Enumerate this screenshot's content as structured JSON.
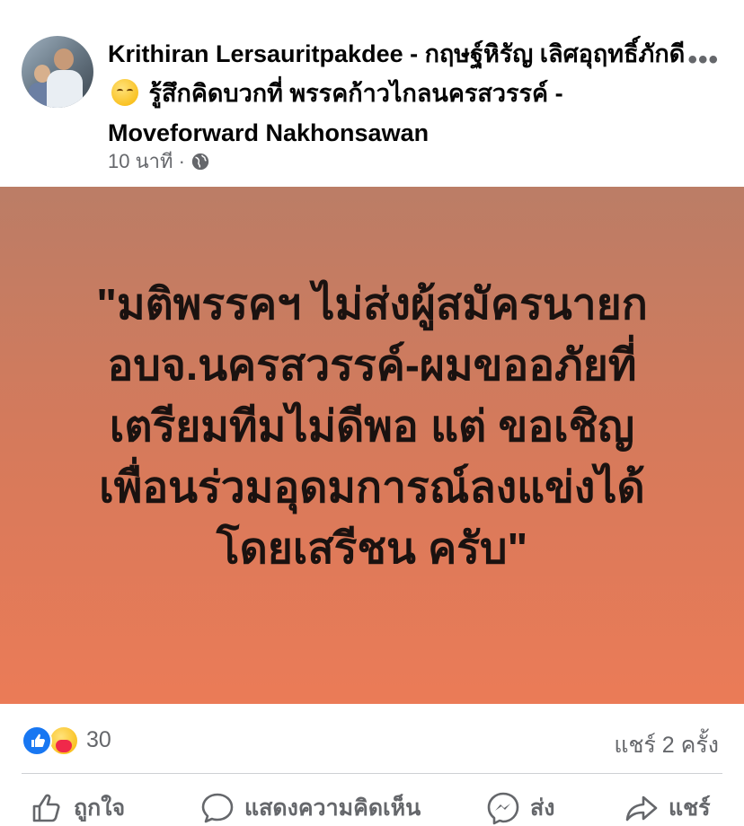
{
  "post": {
    "author_line": "Krithiran Lersauritpakdee - กฤษฐ์หิรัญ เลิศอุฤทธิ์ภักดี",
    "feeling_text": "รู้สึกคิดบวกที่ พรรคก้าวไกลนครสวรรค์ - Moveforward Nakhonsawan",
    "time": "10 นาที",
    "separator": "·",
    "more_label": "•••",
    "image_quote": "\"มติพรรคฯ ไม่ส่งผู้สมัครนายก\nอบจ.นครสวรรค์-ผมขออภัยที่\nเตรียมทีมไม่ดีพอ แต่ ขอเชิญ\nเพื่อนร่วมอุดมการณ์ลงแข่งได้\nโดยเสรีชน ครับ\""
  },
  "stats": {
    "reaction_count": "30",
    "shares_text": "แชร์ 2 ครั้ง"
  },
  "actions": {
    "like": "ถูกใจ",
    "comment": "แสดงความคิดเห็น",
    "send": "ส่ง",
    "share": "แชร์"
  },
  "colors": {
    "accent_blue": "#1877f2",
    "secondary_text": "#65676b",
    "image_top": "#bb7d66",
    "image_bottom": "#eb7b57"
  },
  "icons": [
    "ellipsis-icon",
    "globe-icon",
    "like-reaction-icon",
    "care-reaction-icon",
    "thumbs-up-icon",
    "comment-icon",
    "messenger-icon",
    "share-icon"
  ]
}
